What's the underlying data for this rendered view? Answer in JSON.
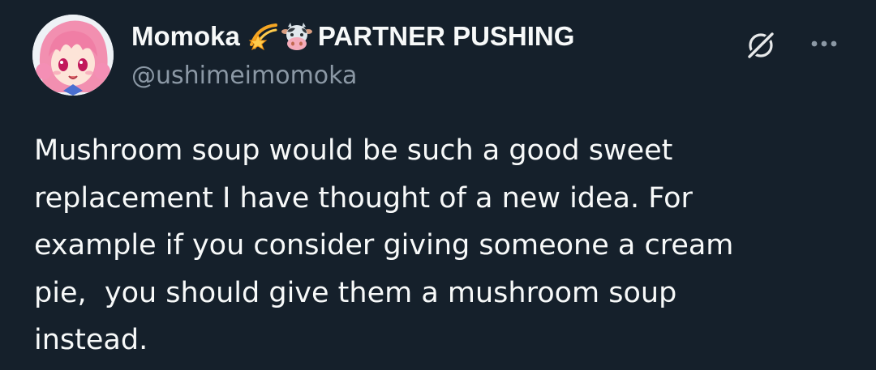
{
  "author": {
    "display_name": "Momoka",
    "badges": [
      "shooting-star-emoji",
      "cow-face-emoji"
    ],
    "affiliation_label": "PARTNER PUSHING",
    "handle": "@ushimeimomoka",
    "avatar": "anime-avatar-pink-hair"
  },
  "actions": {
    "grok_icon": "grok-icon",
    "more_icon": "more-options-icon"
  },
  "tweet": {
    "text": "Mushroom soup would be such a good sweet\nreplacement I have thought of a new idea. For\nexample if you consider giving someone a cream\npie,  you should give them a mushroom soup\ninstead."
  },
  "colors": {
    "background": "#15202b",
    "primary_text": "#f7f9f9",
    "secondary_text": "#8b98a5"
  }
}
